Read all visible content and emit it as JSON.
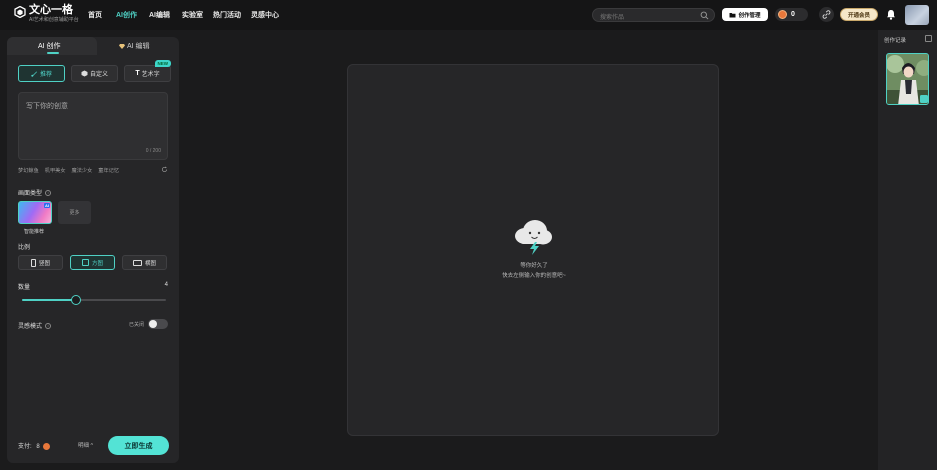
{
  "brand": {
    "title": "文心一格",
    "subtitle": "AI艺术和创意辅助平台"
  },
  "nav": [
    {
      "label": "首页",
      "active": false
    },
    {
      "label": "AI创作",
      "active": true
    },
    {
      "label": "AI编辑",
      "active": false
    },
    {
      "label": "实验室",
      "active": false
    },
    {
      "label": "热门活动",
      "active": false
    },
    {
      "label": "灵感中心",
      "active": false
    }
  ],
  "search": {
    "placeholder": "搜索作品"
  },
  "header": {
    "mgmt_label": "创作管理",
    "coin_count": "0",
    "vip_label": "开通会员"
  },
  "left_panel": {
    "tabs": [
      {
        "label": "AI 创作",
        "active": true
      },
      {
        "label": "AI 编辑",
        "active": false
      }
    ],
    "modes": [
      {
        "label": "推荐",
        "active": true
      },
      {
        "label": "自定义",
        "active": false
      },
      {
        "label": "艺术字",
        "active": false,
        "badge": "NEW"
      }
    ],
    "prompt": {
      "placeholder": "写下你的创意",
      "count": "0 / 200"
    },
    "suggestions": [
      "梦幻鲸鱼",
      "机甲美女",
      "魔法少女",
      "童年记忆"
    ],
    "style_section": {
      "label": "画面类型",
      "selected_caption": "智能推荐",
      "more_label": "更多",
      "ai_tag": "AI"
    },
    "ratio_section": {
      "label": "比例",
      "options": [
        {
          "label": "竖图",
          "active": false
        },
        {
          "label": "方图",
          "active": true
        },
        {
          "label": "横图",
          "active": false
        }
      ]
    },
    "quantity": {
      "label": "数量",
      "value": "4",
      "fraction": 0.375
    },
    "inspiration": {
      "label": "灵感模式",
      "state_label": "已关闭",
      "on": false
    },
    "footer": {
      "pay_label": "支付:",
      "pay_value": "8",
      "detail_label": "明细",
      "generate_label": "立即生成"
    }
  },
  "canvas": {
    "empty_line1": "等你好久了",
    "empty_line2": "快去左侧输入你的创意吧~"
  },
  "history": {
    "title": "创作记录"
  },
  "colors": {
    "accent": "#4fd1c5",
    "coin": "#e9783b",
    "vip": "#f5e7c8"
  }
}
